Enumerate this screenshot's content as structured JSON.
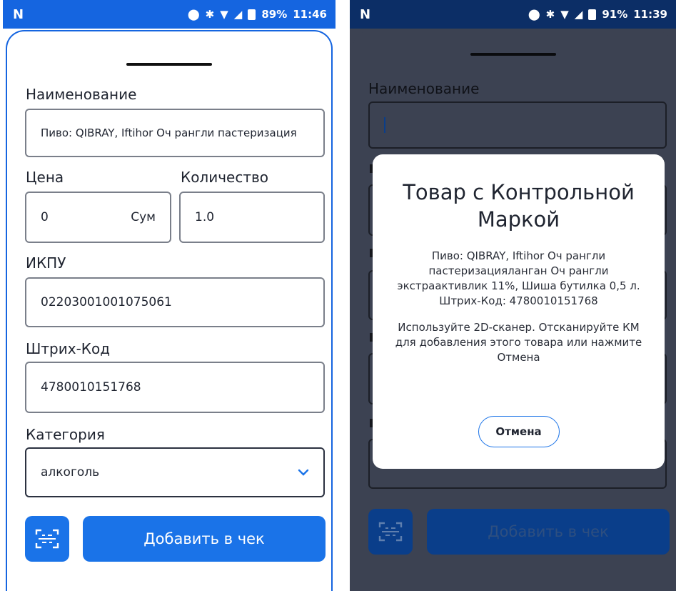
{
  "left": {
    "status": {
      "carrier": "N",
      "battery": "89%",
      "time": "11:46"
    },
    "form": {
      "name_label": "Наименование",
      "name_value": "Пиво: QIBRAY, Iftihor Оч рангли пастеризация",
      "price_label": "Цена",
      "price_value": "0",
      "currency": "Сум",
      "qty_label": "Количество",
      "qty_value": "1.0",
      "ikpu_label": "ИКПУ",
      "ikpu_value": "02203001001075061",
      "barcode_label": "Штрих-Код",
      "barcode_value": "4780010151768",
      "category_label": "Категория",
      "category_value": "алкоголь"
    },
    "add_button": "Добавить в чек"
  },
  "right": {
    "status": {
      "carrier": "N",
      "battery": "91%",
      "time": "11:39"
    },
    "form": {
      "name_label": "Наименование"
    },
    "add_button": "Добавить в чек",
    "dialog": {
      "title": "Товар с Контрольной Маркой",
      "product": "Пиво: QIBRAY, Iftihor Оч рангли пастеризацияланган Оч рангли экстраактивлик 11%, Шиша бутилка 0,5 л. Штрих-Код: 4780010151768",
      "instruction": "Используйте 2D-сканер. Отсканируйте КМ для добавления этого товара или нажмите Отмена",
      "cancel": "Отмена"
    }
  },
  "icons": [
    "location-pin-icon",
    "bluetooth-icon",
    "wifi-icon",
    "signal-icon",
    "battery-icon",
    "chevron-down-icon",
    "scan-icon"
  ],
  "colors": {
    "accent": "#1a73e8",
    "statusbar": "#1565e0"
  }
}
